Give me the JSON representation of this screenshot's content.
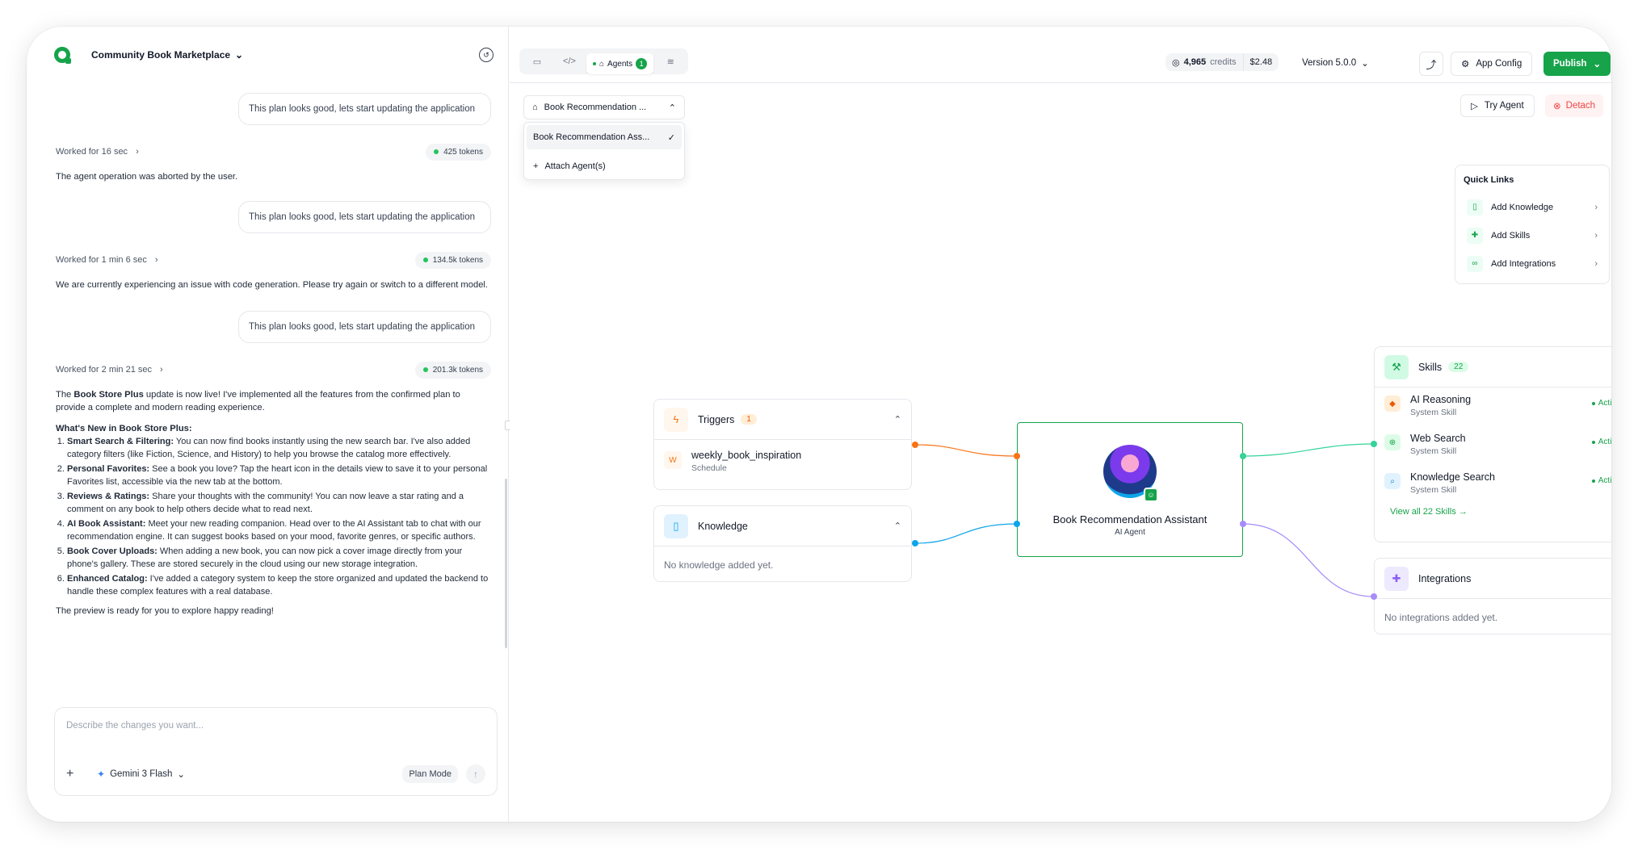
{
  "header": {
    "project_name": "Community Book Marketplace"
  },
  "chat": {
    "user_message": "This plan looks good, lets start updating the application",
    "turns": [
      {
        "worked": "Worked for 16 sec",
        "tokens": "425 tokens",
        "reply": "The agent operation was aborted by the user."
      },
      {
        "worked": "Worked for 1 min 6 sec",
        "tokens": "134.5k tokens",
        "reply": "We are currently experiencing an issue with code generation. Please try again or switch to a different model."
      },
      {
        "worked": "Worked for 2 min 21 sec",
        "tokens": "201.3k tokens"
      }
    ],
    "final": {
      "intro_a": "The ",
      "intro_b": "Book Store Plus",
      "intro_c": " update is now live! I've implemented all the features from the confirmed plan to provide a complete and modern reading experience.",
      "whats_new": "What's New in Book Store Plus:",
      "features": [
        {
          "title": "Smart Search & Filtering:",
          "text": " You can now find books instantly using the new search bar. I've also added category filters (like Fiction, Science, and History) to help you browse the catalog more effectively."
        },
        {
          "title": "Personal Favorites:",
          "text": " See a book you love? Tap the heart icon in the details view to save it to your personal Favorites list, accessible via the new tab at the bottom."
        },
        {
          "title": "Reviews & Ratings:",
          "text": " Share your thoughts with the community! You can now leave a star rating and a comment on any book to help others decide what to read next."
        },
        {
          "title": "AI Book Assistant:",
          "text": " Meet your new reading companion. Head over to the AI Assistant tab to chat with our recommendation engine. It can suggest books based on your mood, favorite genres, or specific authors."
        },
        {
          "title": "Book Cover Uploads:",
          "text": " When adding a new book, you can now pick a cover image directly from your phone's gallery. These are stored securely in the cloud using our new storage integration."
        },
        {
          "title": "Enhanced Catalog:",
          "text": " I've added a category system to keep the store organized and updated the backend to handle these complex features with a real database."
        }
      ],
      "closing": "The preview is ready for you to explore happy reading!"
    }
  },
  "composer": {
    "placeholder": "Describe the changes you want...",
    "model": "Gemini 3 Flash",
    "plan_mode": "Plan Mode"
  },
  "topbar": {
    "agents_tab": "Agents",
    "agents_count": "1",
    "credits": "4,965",
    "credits_label": "credits",
    "cost": "$2.48",
    "version": "Version 5.0.0",
    "app_config": "App Config",
    "publish": "Publish"
  },
  "canvas": {
    "agent_selector": "Book Recommendation ...",
    "dropdown_selected": "Book Recommendation Ass...",
    "dropdown_attach": "Attach Agent(s)",
    "try_agent": "Try Agent",
    "detach": "Detach",
    "quick_links": {
      "title": "Quick Links",
      "items": [
        "Add Knowledge",
        "Add Skills",
        "Add Integrations"
      ]
    },
    "triggers": {
      "title": "Triggers",
      "count": "1",
      "item_letter": "W",
      "item_name": "weekly_book_inspiration",
      "item_sub": "Schedule"
    },
    "knowledge": {
      "title": "Knowledge",
      "empty": "No knowledge added yet."
    },
    "agent": {
      "name": "Book Recommendation Assistant",
      "role": "AI Agent"
    },
    "skills": {
      "title": "Skills",
      "count": "22",
      "items": [
        {
          "name": "AI Reasoning",
          "sub": "System Skill",
          "status": "Active"
        },
        {
          "name": "Web Search",
          "sub": "System Skill",
          "status": "Active"
        },
        {
          "name": "Knowledge Search",
          "sub": "System Skill",
          "status": "Active"
        }
      ],
      "view_all": "View all 22 Skills →"
    },
    "integrations": {
      "title": "Integrations",
      "empty": "No integrations added yet."
    },
    "colors": {
      "accent": "#16a34a",
      "trigger": "#f97316",
      "knowledge": "#0ea5e9",
      "integration": "#a78bfa",
      "skill": "#34d399"
    }
  }
}
